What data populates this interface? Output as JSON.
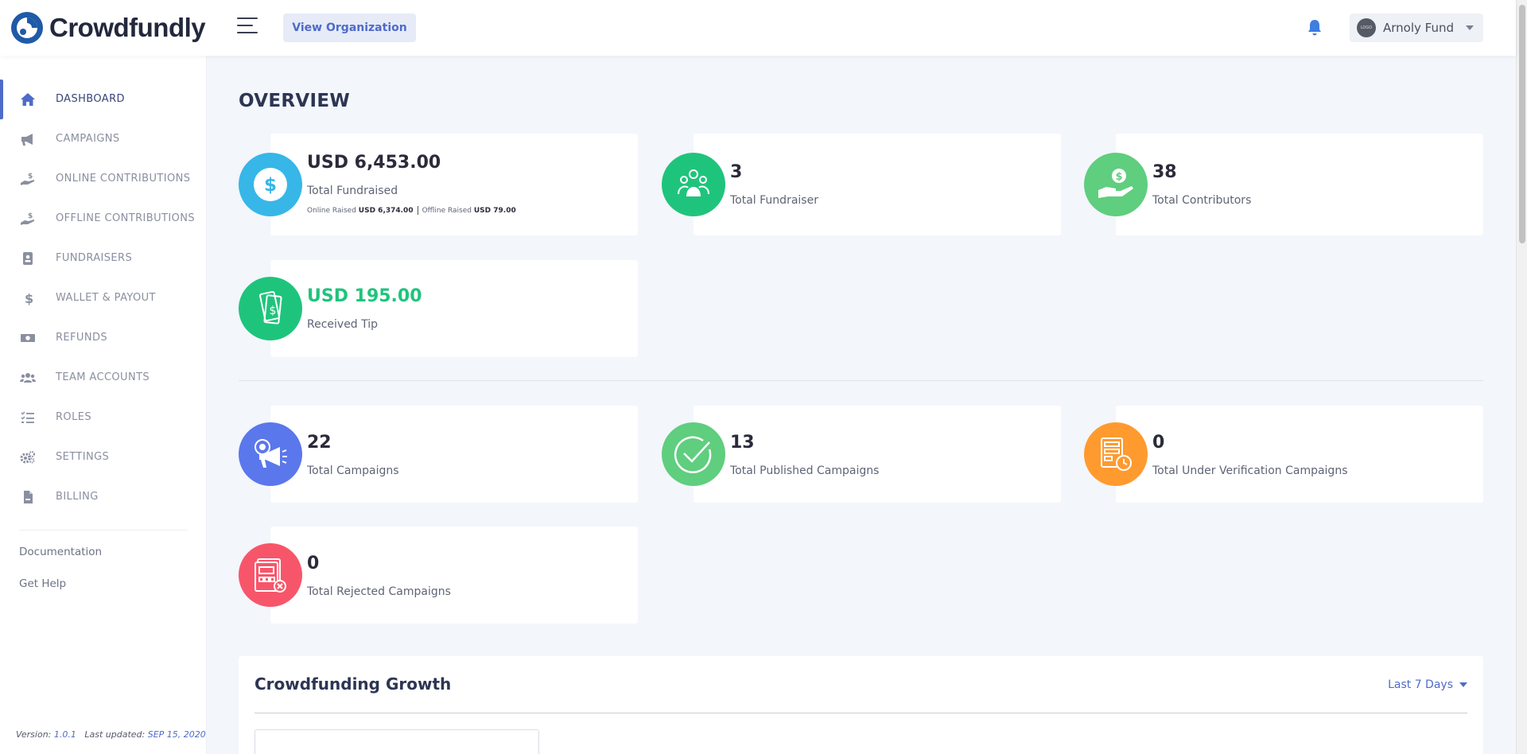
{
  "brand": {
    "name": "Crowdfundly"
  },
  "header": {
    "view_org_label": "View Organization",
    "user": {
      "name": "Arnoly Fund",
      "avatar_text": "LOGO"
    }
  },
  "sidebar": {
    "items": [
      {
        "label": "DASHBOARD",
        "icon": "home-icon",
        "active": true
      },
      {
        "label": "CAMPAIGNS",
        "icon": "megaphone-icon"
      },
      {
        "label": "ONLINE CONTRIBUTIONS",
        "icon": "hand-dollar-icon"
      },
      {
        "label": "OFFLINE CONTRIBUTIONS",
        "icon": "hand-dollar-icon"
      },
      {
        "label": "FUNDRAISERS",
        "icon": "id-card-icon"
      },
      {
        "label": "WALLET & PAYOUT",
        "icon": "dollar-icon"
      },
      {
        "label": "REFUNDS",
        "icon": "money-bill-icon"
      },
      {
        "label": "TEAM ACCOUNTS",
        "icon": "users-icon"
      },
      {
        "label": "ROLES",
        "icon": "tasks-icon"
      },
      {
        "label": "SETTINGS",
        "icon": "cogs-icon"
      },
      {
        "label": "BILLING",
        "icon": "invoice-icon"
      }
    ],
    "links": {
      "documentation": "Documentation",
      "help": "Get Help"
    },
    "version": {
      "label": "Version:",
      "number": "1.0.1",
      "updated_label": "Last updated:",
      "updated_date": "SEP 15, 2020"
    }
  },
  "main": {
    "title": "OVERVIEW",
    "stats": {
      "total_fundraised": {
        "value": "USD 6,453.00",
        "label": "Total Fundraised",
        "online_label": "Online Raised",
        "online_value": "USD 6,374.00",
        "offline_label": "Offline Raised",
        "offline_value": "USD 79.00",
        "color": "#37b6e8"
      },
      "total_fundraiser": {
        "value": "3",
        "label": "Total Fundraiser",
        "color": "#1fc47c"
      },
      "total_contributors": {
        "value": "38",
        "label": "Total Contributors",
        "color": "#5fce7e"
      },
      "received_tip": {
        "value": "USD 195.00",
        "label": "Received Tip",
        "color": "#1fc47c",
        "value_color": "#1fc47c"
      },
      "total_campaigns": {
        "value": "22",
        "label": "Total Campaigns",
        "color": "#5b77ec"
      },
      "published_campaigns": {
        "value": "13",
        "label": "Total Published Campaigns",
        "color": "#5fce7e"
      },
      "verification_campaigns": {
        "value": "0",
        "label": "Total Under Verification Campaigns",
        "color": "#ff9a2f"
      },
      "rejected_campaigns": {
        "value": "0",
        "label": "Total Rejected Campaigns",
        "color": "#f7566a"
      }
    },
    "growth": {
      "title": "Crowdfunding Growth",
      "range_label": "Last 7 Days"
    }
  },
  "colors": {
    "accent": "#4f6bc8",
    "bell": "#3f7de0"
  }
}
